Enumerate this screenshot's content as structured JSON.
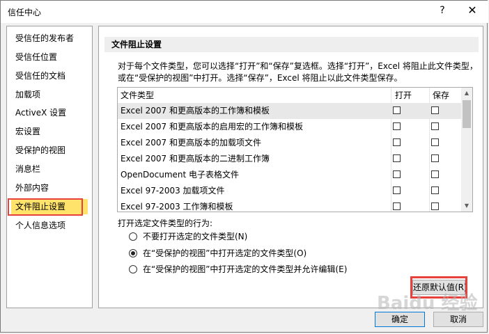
{
  "window": {
    "title": "信任中心",
    "help_label": "?",
    "close_label": "✕"
  },
  "sidebar": {
    "items": [
      {
        "label": "受信任的发布者"
      },
      {
        "label": "受信任位置"
      },
      {
        "label": "受信任的文档"
      },
      {
        "label": "加载项"
      },
      {
        "label": "ActiveX 设置"
      },
      {
        "label": "宏设置"
      },
      {
        "label": "受保护的视图"
      },
      {
        "label": "消息栏"
      },
      {
        "label": "外部内容"
      },
      {
        "label": "文件阻止设置",
        "selected": true
      },
      {
        "label": "个人信息选项"
      }
    ]
  },
  "main": {
    "section_title": "文件阻止设置",
    "description": "对于每个文件类型，您可以选择“打开”和“保存”复选框。选择“打开”，Excel 将阻止此文件类型，或在“受保护的视图”中打开。选择“保存”，Excel 将阻止以此文件类型保存。",
    "table": {
      "columns": {
        "type": "文件类型",
        "open": "打开",
        "save": "保存"
      },
      "rows": [
        {
          "name": "Excel 2007 和更高版本的工作簿和模板",
          "open": false,
          "save": false,
          "selected": true
        },
        {
          "name": "Excel 2007 和更高版本的启用宏的工作簿和模板",
          "open": false,
          "save": false
        },
        {
          "name": "Excel 2007 和更高版本的加载项文件",
          "open": false,
          "save": false
        },
        {
          "name": "Excel 2007 和更高版本的二进制工作簿",
          "open": false,
          "save": false
        },
        {
          "name": "OpenDocument 电子表格文件",
          "open": false,
          "save": false
        },
        {
          "name": "Excel 97-2003 加载项文件",
          "open": false,
          "save": false
        },
        {
          "name": "Excel 97-2003 工作簿和模板",
          "open": false,
          "save": false
        }
      ]
    },
    "behavior": {
      "label": "打开选定文件类型的行为:",
      "options": [
        {
          "label": "不要打开选定的文件类型(N)",
          "checked": false
        },
        {
          "label": "在“受保护的视图”中打开选定的文件类型(O)",
          "checked": true
        },
        {
          "label": "在“受保护的视图”中打开选定的文件类型并允许编辑(E)",
          "checked": false
        }
      ]
    },
    "reset_button": "还原默认值(R)"
  },
  "footer": {
    "ok": "确定",
    "cancel": "取消"
  },
  "watermark": "Baidu 经验",
  "colors": {
    "selected_item": "#ffe36b",
    "annotation_box": "#e8413c",
    "default_button_border": "#0078d7"
  }
}
